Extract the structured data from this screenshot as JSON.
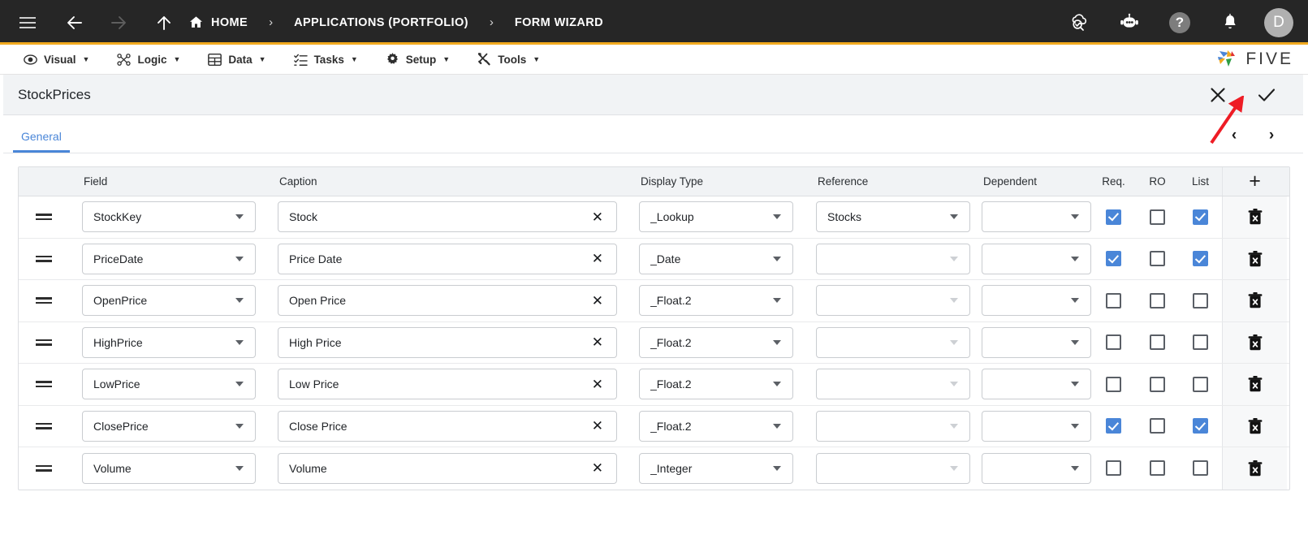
{
  "topbar": {
    "menu_icon": "hamburger-icon",
    "back_icon": "arrow-left-icon",
    "forward_icon": "arrow-right-icon",
    "up_icon": "arrow-up-icon",
    "breadcrumbs": [
      {
        "label": "HOME",
        "icon": "home-icon"
      },
      {
        "label": "APPLICATIONS (PORTFOLIO)",
        "icon": ""
      },
      {
        "label": "FORM WIZARD",
        "icon": ""
      }
    ],
    "separator": "›",
    "right_icons": [
      {
        "name": "cloud-check-icon"
      },
      {
        "name": "chat-bot-icon"
      },
      {
        "name": "help-icon",
        "label": "?"
      },
      {
        "name": "notifications-bell-icon"
      }
    ],
    "avatar_initial": "D"
  },
  "menubar": {
    "items": [
      {
        "label": "Visual",
        "icon": "eye-icon"
      },
      {
        "label": "Logic",
        "icon": "logic-nodes-icon"
      },
      {
        "label": "Data",
        "icon": "table-icon"
      },
      {
        "label": "Tasks",
        "icon": "checklist-icon"
      },
      {
        "label": "Setup",
        "icon": "gear-icon"
      },
      {
        "label": "Tools",
        "icon": "tools-icon"
      }
    ],
    "caret": "▼",
    "brand": "FIVE"
  },
  "formbar": {
    "title": "StockPrices",
    "cancel_icon": "close-x-icon",
    "confirm_icon": "checkmark-icon"
  },
  "tabs": {
    "items": [
      {
        "label": "General",
        "active": true
      }
    ],
    "prev_icon": "‹",
    "next_icon": "›"
  },
  "grid": {
    "columns": [
      "Field",
      "Caption",
      "Display Type",
      "Reference",
      "Dependent",
      "Req.",
      "RO",
      "List"
    ],
    "add_row_icon": "+",
    "delete_icon": "trash-delete-icon",
    "drag_icon": "drag-handle-icon",
    "clear_icon": "✕",
    "rows": [
      {
        "field": "StockKey",
        "caption": "Stock",
        "display_type": "_Lookup",
        "reference": "Stocks",
        "reference_enabled": true,
        "dependent": "",
        "required": true,
        "readonly": false,
        "list": true
      },
      {
        "field": "PriceDate",
        "caption": "Price Date",
        "display_type": "_Date",
        "reference": "",
        "reference_enabled": false,
        "dependent": "",
        "required": true,
        "readonly": false,
        "list": true
      },
      {
        "field": "OpenPrice",
        "caption": "Open Price",
        "display_type": "_Float.2",
        "reference": "",
        "reference_enabled": false,
        "dependent": "",
        "required": false,
        "readonly": false,
        "list": false
      },
      {
        "field": "HighPrice",
        "caption": "High Price",
        "display_type": "_Float.2",
        "reference": "",
        "reference_enabled": false,
        "dependent": "",
        "required": false,
        "readonly": false,
        "list": false
      },
      {
        "field": "LowPrice",
        "caption": "Low Price",
        "display_type": "_Float.2",
        "reference": "",
        "reference_enabled": false,
        "dependent": "",
        "required": false,
        "readonly": false,
        "list": false
      },
      {
        "field": "ClosePrice",
        "caption": "Close Price",
        "display_type": "_Float.2",
        "reference": "",
        "reference_enabled": false,
        "dependent": "",
        "required": true,
        "readonly": false,
        "list": true
      },
      {
        "field": "Volume",
        "caption": "Volume",
        "display_type": "_Integer",
        "reference": "",
        "reference_enabled": false,
        "dependent": "",
        "required": false,
        "readonly": false,
        "list": false
      }
    ]
  },
  "colors": {
    "topbar_bg": "#262626",
    "accent_orange": "#f2aa1f",
    "tab_blue": "#4a86d8",
    "checkbox_blue": "#4a86d8",
    "annotation_red": "#ee1c25"
  }
}
